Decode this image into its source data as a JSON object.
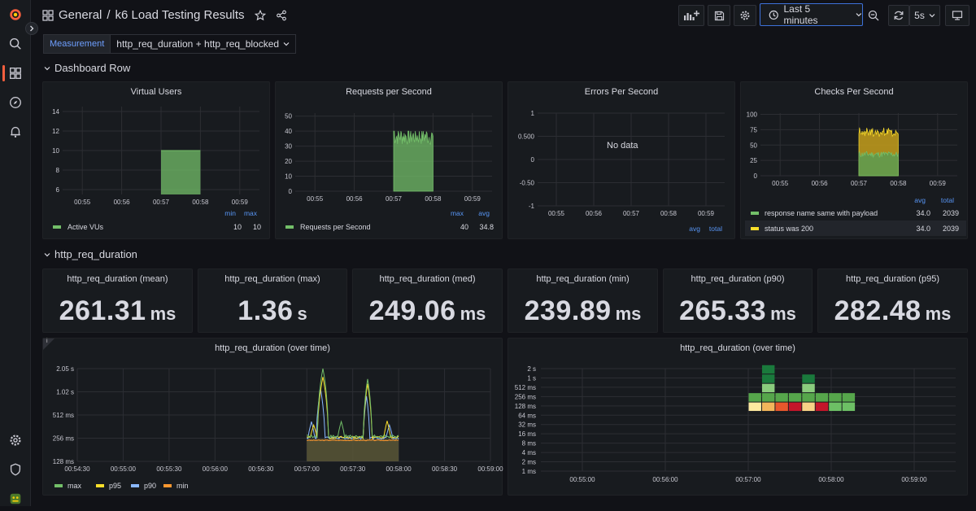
{
  "header": {
    "folder": "General",
    "separator": "/",
    "title": "k6 Load Testing Results",
    "time_range": "Last 5 minutes",
    "refresh_interval": "5s"
  },
  "variables": {
    "label": "Measurement",
    "value": "http_req_duration + http_req_blocked"
  },
  "rows": {
    "dashboard_row": "Dashboard Row",
    "http_req_duration": "http_req_duration"
  },
  "colors": {
    "green": "#73bf69",
    "yellow": "#fade2a",
    "blue": "#5794f2",
    "cyan": "#8ab8ff",
    "orange": "#ff9830",
    "accent": "#3d71d9",
    "brand": "#f55f3e"
  },
  "panels": {
    "virtual_users": {
      "title": "Virtual Users",
      "legend_headers": [
        "min",
        "max"
      ],
      "legend": [
        {
          "name": "Active VUs",
          "values": [
            "10",
            "10"
          ]
        }
      ]
    },
    "requests_per_second": {
      "title": "Requests per Second",
      "legend_headers": [
        "max",
        "avg"
      ],
      "legend": [
        {
          "name": "Requests per Second",
          "values": [
            "40",
            "34.8"
          ]
        }
      ]
    },
    "errors_per_second": {
      "title": "Errors Per Second",
      "no_data": "No data",
      "legend_headers": [
        "avg",
        "total"
      ]
    },
    "checks_per_second": {
      "title": "Checks Per Second",
      "legend_headers": [
        "avg",
        "total"
      ],
      "legend": [
        {
          "name": "response name same with payload",
          "values": [
            "34.0",
            "2039"
          ]
        },
        {
          "name": "status was 200",
          "values": [
            "34.0",
            "2039"
          ]
        }
      ]
    },
    "duration_over_time": {
      "title": "http_req_duration (over time)",
      "legend": [
        "max",
        "p95",
        "p90",
        "min"
      ]
    },
    "duration_heatmap": {
      "title": "http_req_duration (over time)"
    }
  },
  "stats": [
    {
      "title": "http_req_duration (mean)",
      "value": "261.31",
      "unit": "ms"
    },
    {
      "title": "http_req_duration (max)",
      "value": "1.36",
      "unit": "s"
    },
    {
      "title": "http_req_duration (med)",
      "value": "249.06",
      "unit": "ms"
    },
    {
      "title": "http_req_duration (min)",
      "value": "239.89",
      "unit": "ms"
    },
    {
      "title": "http_req_duration (p90)",
      "value": "265.33",
      "unit": "ms"
    },
    {
      "title": "http_req_duration (p95)",
      "value": "282.48",
      "unit": "ms"
    }
  ],
  "chart_data": [
    {
      "type": "area",
      "title": "Virtual Users",
      "x_ticks": [
        "00:55",
        "00:56",
        "00:57",
        "00:58",
        "00:59"
      ],
      "y_ticks": [
        6,
        8,
        10,
        12,
        14
      ],
      "ylim": [
        5.5,
        14.5
      ],
      "series": [
        {
          "name": "Active VUs",
          "x_range": [
            "00:57:00",
            "00:58:00"
          ],
          "value": 10
        }
      ]
    },
    {
      "type": "area",
      "title": "Requests per Second",
      "x_ticks": [
        "00:55",
        "00:56",
        "00:57",
        "00:58",
        "00:59"
      ],
      "y_ticks": [
        0,
        10,
        20,
        30,
        40,
        50
      ],
      "ylim": [
        0,
        52
      ],
      "series": [
        {
          "name": "Requests per Second",
          "x_range": [
            "00:57:00",
            "00:58:00"
          ],
          "max": 40,
          "avg": 34.8
        }
      ]
    },
    {
      "type": "line",
      "title": "Errors Per Second",
      "x_ticks": [
        "00:55",
        "00:56",
        "00:57",
        "00:58",
        "00:59"
      ],
      "y_ticks": [
        "1",
        "0.500",
        "0",
        "-0.50",
        "-1"
      ],
      "ylim": [
        -1,
        1
      ],
      "series": []
    },
    {
      "type": "area",
      "title": "Checks Per Second",
      "x_ticks": [
        "00:55",
        "00:56",
        "00:57",
        "00:58",
        "00:59"
      ],
      "y_ticks": [
        0,
        25,
        50,
        75,
        100
      ],
      "ylim": [
        0,
        102
      ],
      "stacked": true,
      "series": [
        {
          "name": "response name same with payload",
          "x_range": [
            "00:57:00",
            "00:58:00"
          ],
          "avg": 34.0,
          "total": 2039
        },
        {
          "name": "status was 200",
          "x_range": [
            "00:57:00",
            "00:58:00"
          ],
          "avg": 34.0,
          "total": 2039
        }
      ]
    },
    {
      "type": "line",
      "title": "http_req_duration (over time)",
      "x_ticks": [
        "00:54:30",
        "00:55:00",
        "00:55:30",
        "00:56:00",
        "00:56:30",
        "00:57:00",
        "00:57:30",
        "00:58:00",
        "00:58:30",
        "00:59:00"
      ],
      "y_ticks": [
        "128 ms",
        "256 ms",
        "512 ms",
        "1.02 s",
        "2.05 s"
      ],
      "yscale": "log2",
      "series": [
        {
          "name": "max",
          "peak": "2.05 s",
          "base": "256 ms"
        },
        {
          "name": "p95",
          "peak": "1.6 s",
          "base": "256 ms"
        },
        {
          "name": "p90",
          "peak": "450 ms",
          "base": "256 ms"
        },
        {
          "name": "min",
          "base": "240 ms"
        }
      ]
    },
    {
      "type": "heatmap",
      "title": "http_req_duration (over time)",
      "x_ticks": [
        "00:55:00",
        "00:56:00",
        "00:57:00",
        "00:58:00",
        "00:59:00"
      ],
      "y_ticks": [
        "1 ms",
        "2 ms",
        "4 ms",
        "8 ms",
        "16 ms",
        "32 ms",
        "64 ms",
        "128 ms",
        "256 ms",
        "512 ms",
        "1 s",
        "2 s"
      ],
      "buckets": [
        {
          "y": "128 ms",
          "cells": [
            "#fde9a0",
            "#f2b65b",
            "#e8572c",
            "#c4162a",
            "#f7d286",
            "#c4162a",
            "#6dbf65",
            "#6dbf65"
          ]
        },
        {
          "y": "256 ms",
          "cells": [
            "#56a64b",
            "#56a64b",
            "#56a64b",
            "#56a64b",
            "#56a64b",
            "#56a64b",
            "#56a64b",
            "#56a64b"
          ]
        },
        {
          "y": "512 ms",
          "cells": [
            null,
            "#8acc7d",
            null,
            null,
            "#8acc7d",
            null,
            null,
            null
          ]
        },
        {
          "y": "1 s",
          "cells": [
            null,
            "#1a7a3c",
            null,
            null,
            "#1a7a3c",
            null,
            null,
            null
          ]
        },
        {
          "y": "2 s",
          "cells": [
            null,
            "#1a7a3c",
            null,
            null,
            null,
            null,
            null,
            null
          ]
        }
      ]
    }
  ]
}
